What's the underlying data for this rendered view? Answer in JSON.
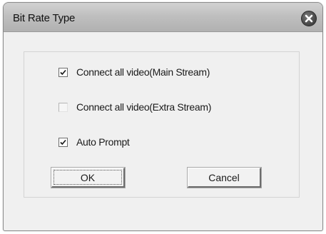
{
  "window": {
    "title": "Bit Rate Type",
    "close_icon": "close-icon"
  },
  "options": {
    "main_stream": {
      "label": "Connect all video(Main Stream)",
      "checked": true
    },
    "extra_stream": {
      "label": "Connect all video(Extra Stream)",
      "checked": false
    },
    "auto_prompt": {
      "label": "Auto Prompt",
      "checked": true
    }
  },
  "buttons": {
    "ok_label": "OK",
    "cancel_label": "Cancel"
  },
  "colors": {
    "titlebar": "#c2c2c2",
    "dialog_bg": "#f0f0f0",
    "close_button": "#4a4a4a"
  }
}
